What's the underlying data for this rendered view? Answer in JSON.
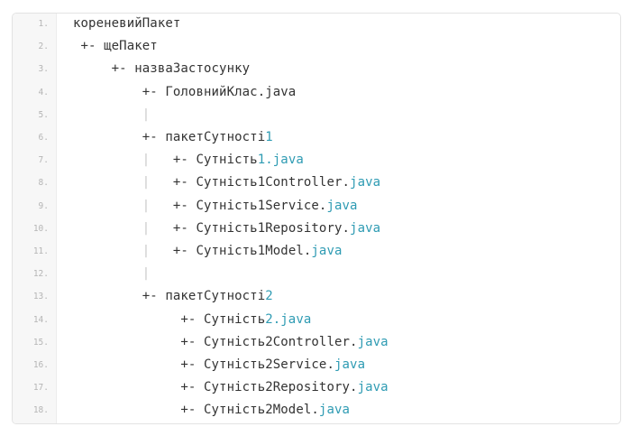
{
  "code_block": {
    "lines": [
      {
        "num": "1.",
        "parts": [
          {
            "t": "кореневийПакет"
          }
        ]
      },
      {
        "num": "2.",
        "parts": [
          {
            "t": " +- щеПакет"
          }
        ]
      },
      {
        "num": "3.",
        "parts": [
          {
            "t": "     +- назваЗастосунку"
          }
        ]
      },
      {
        "num": "4.",
        "parts": [
          {
            "t": "         +- ГоловнийКлас.java"
          }
        ]
      },
      {
        "num": "5.",
        "parts": [
          {
            "t": "         "
          },
          {
            "t": "|",
            "c": "bar"
          }
        ]
      },
      {
        "num": "6.",
        "parts": [
          {
            "t": "         +- пакетСутності"
          },
          {
            "t": "1",
            "c": "kw"
          }
        ]
      },
      {
        "num": "7.",
        "parts": [
          {
            "t": "         "
          },
          {
            "t": "|",
            "c": "bar"
          },
          {
            "t": "   +- Сутність"
          },
          {
            "t": "1.java",
            "c": "kw"
          }
        ]
      },
      {
        "num": "8.",
        "parts": [
          {
            "t": "         "
          },
          {
            "t": "|",
            "c": "bar"
          },
          {
            "t": "   +- Сутність1Controller."
          },
          {
            "t": "java",
            "c": "kw"
          }
        ]
      },
      {
        "num": "9.",
        "parts": [
          {
            "t": "         "
          },
          {
            "t": "|",
            "c": "bar"
          },
          {
            "t": "   +- Сутність1Service."
          },
          {
            "t": "java",
            "c": "kw"
          }
        ]
      },
      {
        "num": "10.",
        "parts": [
          {
            "t": "         "
          },
          {
            "t": "|",
            "c": "bar"
          },
          {
            "t": "   +- Сутність1Repository."
          },
          {
            "t": "java",
            "c": "kw"
          }
        ]
      },
      {
        "num": "11.",
        "parts": [
          {
            "t": "         "
          },
          {
            "t": "|",
            "c": "bar"
          },
          {
            "t": "   +- Сутність1Model."
          },
          {
            "t": "java",
            "c": "kw"
          }
        ]
      },
      {
        "num": "12.",
        "parts": [
          {
            "t": "         "
          },
          {
            "t": "|",
            "c": "bar"
          }
        ]
      },
      {
        "num": "13.",
        "parts": [
          {
            "t": "         +- пакетСутності"
          },
          {
            "t": "2",
            "c": "kw"
          }
        ]
      },
      {
        "num": "14.",
        "parts": [
          {
            "t": "              +- Сутність"
          },
          {
            "t": "2.java",
            "c": "kw"
          }
        ]
      },
      {
        "num": "15.",
        "parts": [
          {
            "t": "              +- Сутність2Controller."
          },
          {
            "t": "java",
            "c": "kw"
          }
        ]
      },
      {
        "num": "16.",
        "parts": [
          {
            "t": "              +- Сутність2Service."
          },
          {
            "t": "java",
            "c": "kw"
          }
        ]
      },
      {
        "num": "17.",
        "parts": [
          {
            "t": "              +- Сутність2Repository."
          },
          {
            "t": "java",
            "c": "kw"
          }
        ]
      },
      {
        "num": "18.",
        "parts": [
          {
            "t": "              +- Сутність2Model."
          },
          {
            "t": "java",
            "c": "kw"
          }
        ]
      }
    ]
  }
}
